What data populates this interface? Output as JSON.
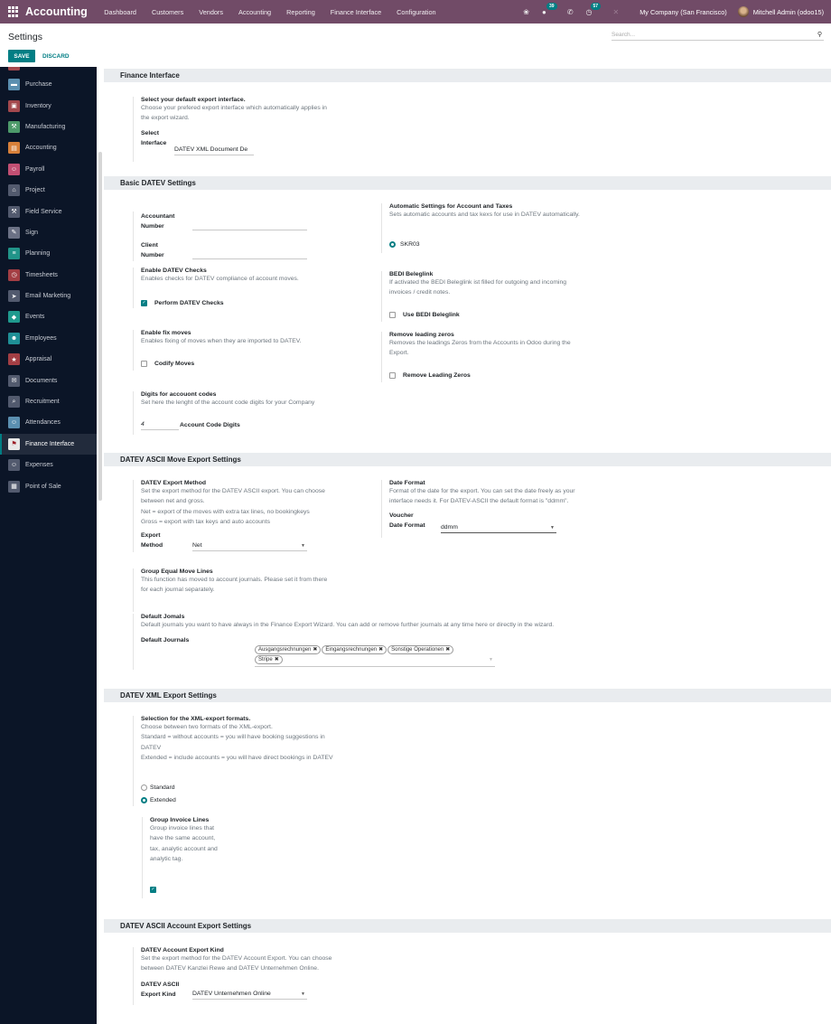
{
  "topbar": {
    "app_name": "Accounting",
    "menu": [
      "Dashboard",
      "Customers",
      "Vendors",
      "Accounting",
      "Reporting",
      "Finance Interface",
      "Configuration"
    ],
    "messages_count": "39",
    "activities_count": "57",
    "company": "My Company (San Francisco)",
    "user": "Mitchell Admin (odoo15)"
  },
  "control_panel": {
    "title": "Settings",
    "save_label": "SAVE",
    "discard_label": "DISCARD",
    "search_placeholder": "Search..."
  },
  "sidebar": {
    "items": [
      {
        "label": "Purchase",
        "icon": "purchase-icon",
        "color": "#5b8fb0"
      },
      {
        "label": "Inventory",
        "icon": "inventory-icon",
        "color": "#a3484d"
      },
      {
        "label": "Manufacturing",
        "icon": "manufacturing-icon",
        "color": "#4d9a6a"
      },
      {
        "label": "Accounting",
        "icon": "accounting-icon",
        "color": "#d7803a"
      },
      {
        "label": "Payroll",
        "icon": "payroll-icon",
        "color": "#c24f73"
      },
      {
        "label": "Project",
        "icon": "project-icon",
        "color": "#525a6e"
      },
      {
        "label": "Field Service",
        "icon": "field-service-icon",
        "color": "#525a6e"
      },
      {
        "label": "Sign",
        "icon": "sign-icon",
        "color": "#6b7185"
      },
      {
        "label": "Planning",
        "icon": "planning-icon",
        "color": "#219489"
      },
      {
        "label": "Timesheets",
        "icon": "timesheets-icon",
        "color": "#a33e44"
      },
      {
        "label": "Email Marketing",
        "icon": "email-marketing-icon",
        "color": "#525a6e"
      },
      {
        "label": "Events",
        "icon": "events-icon",
        "color": "#1f9a8e"
      },
      {
        "label": "Employees",
        "icon": "employees-icon",
        "color": "#1f8f96"
      },
      {
        "label": "Appraisal",
        "icon": "appraisal-icon",
        "color": "#a33e44"
      },
      {
        "label": "Documents",
        "icon": "documents-icon",
        "color": "#525a6e"
      },
      {
        "label": "Recruitment",
        "icon": "recruitment-icon",
        "color": "#525a6e"
      },
      {
        "label": "Attendances",
        "icon": "attendances-icon",
        "color": "#5b8fb0"
      },
      {
        "label": "Finance Interface",
        "icon": "finance-interface-icon",
        "color": "#e8e8e8",
        "active": true
      },
      {
        "label": "Expenses",
        "icon": "expenses-icon",
        "color": "#525a6e"
      },
      {
        "label": "Point of Sale",
        "icon": "point-of-sale-icon",
        "color": "#525a6e"
      }
    ]
  },
  "sections": {
    "finance_interface": {
      "header": "Finance Interface",
      "title": "Select your default export interface.",
      "desc1": "Choose your prefered export interface which automatically applies in",
      "desc2": "the export wizard.",
      "label1": "Select",
      "label2": "Interface",
      "value": "DATEV XML Document De"
    },
    "basic_datev": {
      "header": "Basic DATEV Settings",
      "accountant_label1": "Accountant",
      "accountant_label2": "Number",
      "accountant_value": "",
      "client_label1": "Client",
      "client_label2": "Number",
      "client_value": "",
      "checks_title": "Enable DATEV Checks",
      "checks_desc": "Enables checks for DATEV compliance of account moves.",
      "checks_option": "Perform DATEV Checks",
      "checks_checked": true,
      "fix_title": "Enable fix moves",
      "fix_desc": "Enables fixing of moves when they are imported to DATEV.",
      "fix_option": "Codify Moves",
      "fix_checked": false,
      "digits_title": "Digits for accouont codes",
      "digits_desc": "Set here the lenght of the account code digits for your Company",
      "digits_value": "4",
      "digits_label": "Account Code Digits",
      "auto_title": "Automatic Settings for Account and Taxes",
      "auto_desc": "Sets automatic accounts and tax kexs for use in DATEV automatically.",
      "auto_option": "SKR03",
      "bedi_title": "BEDI Beleglink",
      "bedi_desc1": "If activated the BEDI Beleglink ist filled for outgoing and incoming",
      "bedi_desc2": "invoices / credit notes.",
      "bedi_option": "Use BEDI Beleglink",
      "bedi_checked": false,
      "zeros_title": "Remove leading zeros",
      "zeros_desc1": "Removes the leadings Zeros from the Accounts in Odoo during the",
      "zeros_desc2": "Export.",
      "zeros_option": "Remove Leading Zeros",
      "zeros_checked": false
    },
    "ascii_move": {
      "header": "DATEV ASCII Move Export Settings",
      "method_title": "DATEV Export Method",
      "method_desc1": "Set the export method for the DATEV ASCII export. You can choose",
      "method_desc2": "between net and gross.",
      "method_desc3": "Net = export of the moves with extra tax lines, no bookingkeys",
      "method_desc4": "Gross = export with tax keys and auto accounts",
      "method_label1": "Export",
      "method_label2": "Method",
      "method_value": "Net",
      "group_title": "Group Equal Move Lines",
      "group_desc1": "This function has moved to account journals. Please set it from there",
      "group_desc2": "for each journal separately.",
      "date_title": "Date Format",
      "date_desc1": "Format of the date for the export. You can set the date freely as your",
      "date_desc2": "interface needs it. For DATEV-ASCII the default format is \"ddmm\".",
      "date_label1": "Voucher",
      "date_label2": "Date Format",
      "date_value": "ddmm",
      "journals_title": "Default Jomals",
      "journals_desc": "Default journals you want to have always in the Finance Export Wizard. You can add or remove further journals at any time here or directly in the wizard.",
      "journals_label": "Default Journals",
      "journals": [
        "Ausgangsrechnungen",
        "Eingangsrechnungen",
        "Sonstige Operationen",
        "Stripe"
      ]
    },
    "xml_export": {
      "header": "DATEV XML Export Settings",
      "title": "Selection for the XML-export formats.",
      "desc1": "Choose between two formats of the XML-export.",
      "desc2": "Standard = without accounts = you will have booking suggestions in",
      "desc3": "DATEV",
      "desc4": "Extended = include accounts = you will have direct bookings in DATEV",
      "option_standard": "Standard",
      "option_extended": "Extended",
      "selected": "Extended",
      "group_title": "Group Invoice Lines",
      "group_desc1": "Group invoice lines that",
      "group_desc2": "have the same account,",
      "group_desc3": "tax, analytic account and",
      "group_desc4": "analytic tag.",
      "group_checked": true
    },
    "ascii_account": {
      "header": "DATEV ASCII Account Export Settings",
      "title": "DATEV Account Export Kind",
      "desc1": "Set the export method for the DATEV Account Export. You can choose",
      "desc2": "between DATEV Kanzlei Rewe and DATEV Unternehmen Online.",
      "label1": "DATEV ASCII",
      "label2": "Export Kind",
      "value": "DATEV Unternehmen Online"
    }
  },
  "colors": {
    "brand": "#714b67",
    "primary": "#017e84",
    "sidebar_bg": "#0b1527",
    "section_header_bg": "#e9ecef"
  }
}
